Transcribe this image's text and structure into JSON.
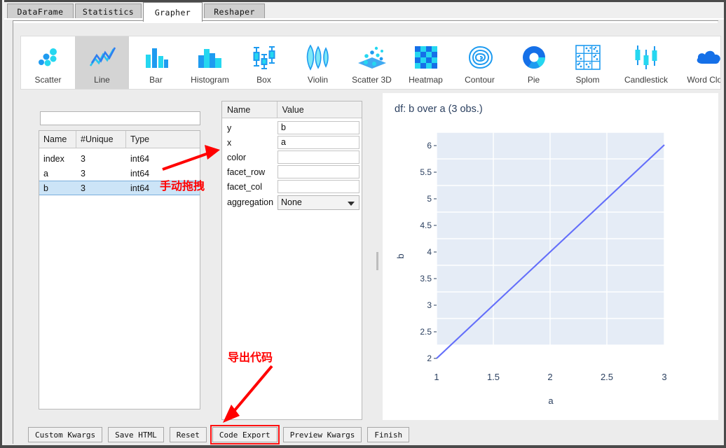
{
  "window": {
    "tabs": [
      {
        "label": "DataFrame",
        "active": false
      },
      {
        "label": "Statistics",
        "active": false
      },
      {
        "label": "Grapher",
        "active": true
      },
      {
        "label": "Reshaper",
        "active": false
      }
    ]
  },
  "chart_types": [
    {
      "label": "Scatter",
      "icon": "scatter-icon",
      "selected": false
    },
    {
      "label": "Line",
      "icon": "line-icon",
      "selected": true
    },
    {
      "label": "Bar",
      "icon": "bar-icon",
      "selected": false
    },
    {
      "label": "Histogram",
      "icon": "histogram-icon",
      "selected": false
    },
    {
      "label": "Box",
      "icon": "box-icon",
      "selected": false
    },
    {
      "label": "Violin",
      "icon": "violin-icon",
      "selected": false
    },
    {
      "label": "Scatter 3D",
      "icon": "scatter3d-icon",
      "selected": false
    },
    {
      "label": "Heatmap",
      "icon": "heatmap-icon",
      "selected": false
    },
    {
      "label": "Contour",
      "icon": "contour-icon",
      "selected": false
    },
    {
      "label": "Pie",
      "icon": "pie-icon",
      "selected": false
    },
    {
      "label": "Splom",
      "icon": "splom-icon",
      "selected": false
    },
    {
      "label": "Candlestick",
      "icon": "candlestick-icon",
      "selected": false
    },
    {
      "label": "Word Cloud",
      "icon": "wordcloud-icon",
      "selected": false
    }
  ],
  "search": {
    "value": "",
    "placeholder": ""
  },
  "fields_table": {
    "columns": [
      "Name",
      "#Unique",
      "Type"
    ],
    "rows": [
      {
        "name": "index",
        "unique": "3",
        "type": "int64",
        "selected": false
      },
      {
        "name": "a",
        "unique": "3",
        "type": "int64",
        "selected": false
      },
      {
        "name": "b",
        "unique": "3",
        "type": "int64",
        "selected": true
      }
    ]
  },
  "properties": {
    "columns": [
      "Name",
      "Value"
    ],
    "rows": [
      {
        "name": "y",
        "value": "b",
        "kind": "input"
      },
      {
        "name": "x",
        "value": "a",
        "kind": "input"
      },
      {
        "name": "color",
        "value": "",
        "kind": "input"
      },
      {
        "name": "facet_row",
        "value": "",
        "kind": "input"
      },
      {
        "name": "facet_col",
        "value": "",
        "kind": "input"
      },
      {
        "name": "aggregation",
        "value": "None",
        "kind": "select"
      }
    ]
  },
  "buttons": [
    {
      "label": "Custom Kwargs",
      "highlight": false
    },
    {
      "label": "Save HTML",
      "highlight": false
    },
    {
      "label": "Reset",
      "highlight": false
    },
    {
      "label": "Code Export",
      "highlight": true
    },
    {
      "label": "Preview Kwargs",
      "highlight": false
    },
    {
      "label": "Finish",
      "highlight": false
    }
  ],
  "annotations": [
    {
      "name": "manual-drag",
      "text": "手动拖拽"
    },
    {
      "name": "export-code",
      "text": "导出代码"
    }
  ],
  "colors": {
    "accent": "#1e9bf0",
    "line": "#636efa",
    "plot_bg": "#e5ecf6",
    "annotation": "#ff0000",
    "title_text": "#2a3f5f",
    "selection": "#cce4f7"
  },
  "chart_data": {
    "type": "line",
    "title": "df: b  over a (3 obs.)",
    "xlabel": "a",
    "ylabel": "b",
    "x": [
      1,
      2,
      3
    ],
    "y": [
      2,
      4,
      6
    ],
    "xlim": [
      1,
      3
    ],
    "ylim": [
      1.85,
      6.15
    ],
    "xticks": [
      "1",
      "1.5",
      "2",
      "2.5",
      "3"
    ],
    "xtick_values": [
      1,
      1.5,
      2,
      2.5,
      3
    ],
    "yticks": [
      "2",
      "2.5",
      "3",
      "3.5",
      "4",
      "4.5",
      "5",
      "5.5",
      "6"
    ],
    "ytick_values": [
      2,
      2.5,
      3,
      3.5,
      4,
      4.5,
      5,
      5.5,
      6
    ],
    "grid": true,
    "legend": "none",
    "series": [
      {
        "name": "b",
        "values": [
          2,
          4,
          6
        ],
        "color": "#636efa"
      }
    ]
  }
}
